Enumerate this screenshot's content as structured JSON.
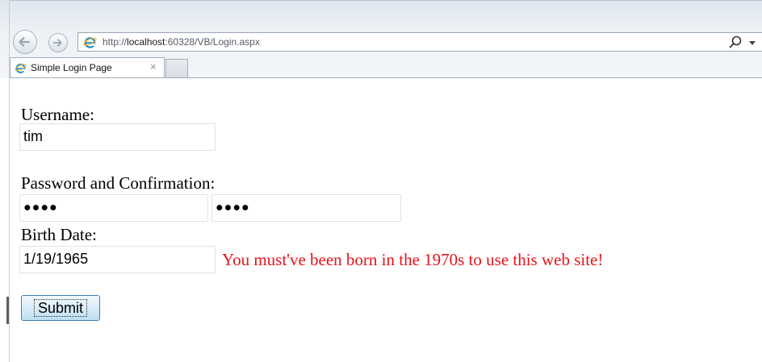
{
  "browser": {
    "address_prefix": "http://",
    "address_host": "localhost",
    "address_rest": ":60328/VB/Login.aspx",
    "tab_title": "Simple Login Page",
    "tab_close": "×"
  },
  "form": {
    "username_label": "Username:",
    "username_value": "tim",
    "password_label": "Password and Confirmation:",
    "password_mask": "●●●●",
    "confirm_mask": "●●●●",
    "birthdate_label": "Birth Date:",
    "birthdate_value": "1/19/1965",
    "birthdate_error": "You must've been born in the 1970s to use this web site!",
    "submit_label": "Submit"
  },
  "colors": {
    "error": "#e8121a",
    "ie_blue": "#1f8fd9",
    "button_border": "#3c7fb1"
  }
}
